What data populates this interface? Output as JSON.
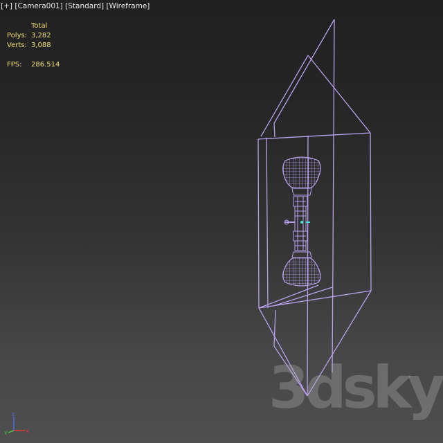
{
  "viewport": {
    "label_plus": "[+]",
    "label_camera": "[Camera001]",
    "label_shading": "[Standard]",
    "label_mode": "[Wireframe]"
  },
  "stats": {
    "header": "Total",
    "polys_label": "Polys:",
    "polys_value": "3,282",
    "verts_label": "Verts:",
    "verts_value": "3,088",
    "fps_label": "FPS:",
    "fps_value": "286.514"
  },
  "watermark": {
    "text": "3dsky"
  },
  "gizmo": {
    "x_label": "x",
    "y_label": "y",
    "z_label": "z"
  },
  "colors": {
    "wireframe": "#b8a2f0",
    "stats_text": "#f2e07a",
    "label_text": "#e8e8e8",
    "axis_x": "#e23a3a",
    "axis_y": "#46c046",
    "axis_z": "#4a6af0",
    "cyan_pivot": "#3ee6d6"
  }
}
